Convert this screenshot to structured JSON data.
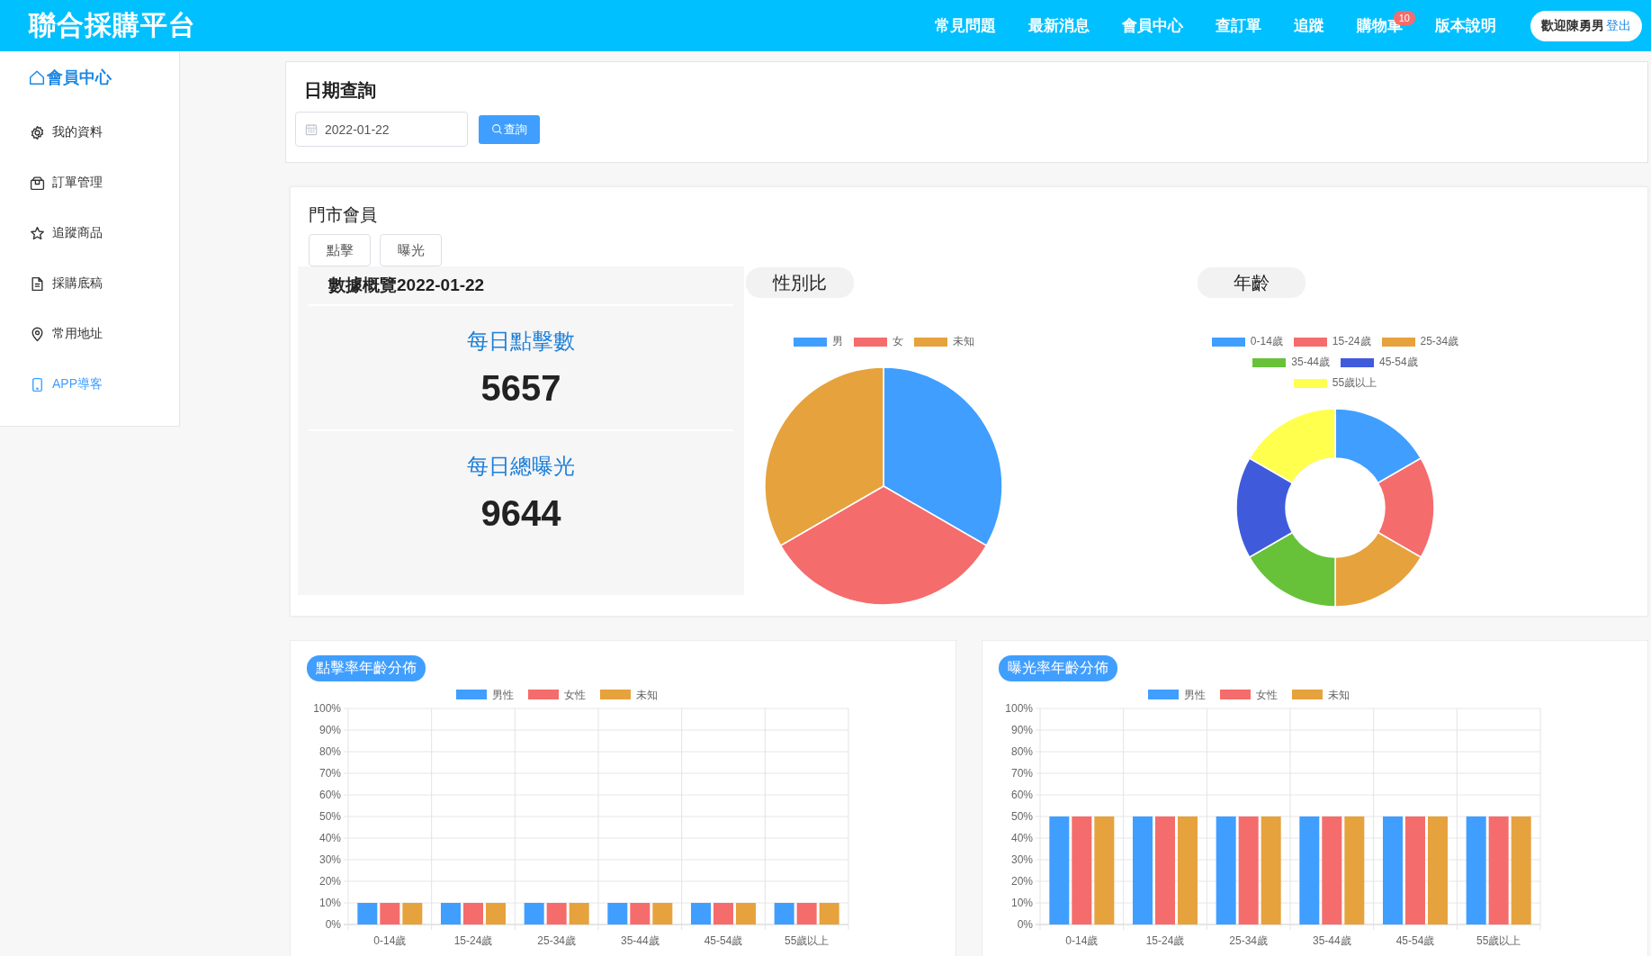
{
  "header": {
    "title": "聯合採購平台",
    "nav": [
      {
        "label": "常見問題"
      },
      {
        "label": "最新消息"
      },
      {
        "label": "會員中心"
      },
      {
        "label": "查訂單"
      },
      {
        "label": "追蹤"
      },
      {
        "label": "購物車",
        "badge": "10"
      },
      {
        "label": "版本說明"
      }
    ],
    "welcome": "歡迎陳勇男",
    "logout": "登出"
  },
  "sidebar": {
    "heading": "會員中心",
    "items": [
      {
        "label": "我的資料",
        "kind": "gear",
        "selected": false
      },
      {
        "label": "訂單管理",
        "kind": "box",
        "selected": false
      },
      {
        "label": "追蹤商品",
        "kind": "star",
        "selected": false
      },
      {
        "label": "採購底稿",
        "kind": "document",
        "selected": false
      },
      {
        "label": "常用地址",
        "kind": "pin",
        "selected": false
      },
      {
        "label": "APP導客",
        "kind": "phone",
        "selected": true
      }
    ]
  },
  "date_query": {
    "title": "日期查詢",
    "date_field": {
      "value": "2022-01-22"
    },
    "button": "查詢"
  },
  "store_members": {
    "title": "門市會員",
    "tabs": [
      "點擊",
      "曝光"
    ],
    "overview": {
      "title": "數據概覽2022-01-22",
      "stats": [
        {
          "label": "每日點擊數",
          "value": "5657"
        },
        {
          "label": "每日總曝光",
          "value": "9644"
        }
      ]
    },
    "gender_chart": {
      "title": "性別比",
      "legend": [
        {
          "label": "男",
          "color": "#409eff"
        },
        {
          "label": "女",
          "color": "#f56c6c"
        },
        {
          "label": "未知",
          "color": "#e6a23c"
        }
      ]
    },
    "age_chart": {
      "title": "年齡",
      "legend": [
        {
          "label": "0-14歲",
          "color": "#409eff"
        },
        {
          "label": "15-24歲",
          "color": "#f56c6c"
        },
        {
          "label": "25-34歲",
          "color": "#e6a23c"
        },
        {
          "label": "35-44歲",
          "color": "#67c23a"
        },
        {
          "label": "45-54歲",
          "color": "#3f5bdc"
        },
        {
          "label": "55歲以上",
          "color": "#ffff4d"
        }
      ]
    }
  },
  "click_rate_chart": {
    "title": "點擊率年齡分佈",
    "chart_data": {
      "type": "bar",
      "categories": [
        "0-14歲",
        "15-24歲",
        "25-34歲",
        "35-44歲",
        "45-54歲",
        "55歲以上"
      ],
      "series": [
        {
          "name": "男性",
          "color": "#409eff",
          "values": [
            10,
            10,
            10,
            10,
            10,
            10
          ]
        },
        {
          "name": "女性",
          "color": "#f56c6c",
          "values": [
            10,
            10,
            10,
            10,
            10,
            10
          ]
        },
        {
          "name": "未知",
          "color": "#e6a23c",
          "values": [
            10,
            10,
            10,
            10,
            10,
            10
          ]
        }
      ],
      "grid": true,
      "legend": true,
      "ylim": [
        0,
        100
      ],
      "yticks": [
        {
          "value": 0,
          "label": "0%"
        },
        {
          "value": 10,
          "label": "10%"
        },
        {
          "value": 20,
          "label": "20%"
        },
        {
          "value": 30,
          "label": "30%"
        },
        {
          "value": 40,
          "label": "40%"
        },
        {
          "value": 50,
          "label": "50%"
        },
        {
          "value": 60,
          "label": "60%"
        },
        {
          "value": 70,
          "label": "70%"
        },
        {
          "value": 80,
          "label": "80%"
        },
        {
          "value": 90,
          "label": "90%"
        },
        {
          "value": 100,
          "label": "100%"
        }
      ]
    }
  },
  "exposure_rate_chart": {
    "title": "曝光率年齡分佈",
    "chart_data": {
      "type": "bar",
      "categories": [
        "0-14歲",
        "15-24歲",
        "25-34歲",
        "35-44歲",
        "45-54歲",
        "55歲以上"
      ],
      "series": [
        {
          "name": "男性",
          "color": "#409eff",
          "values": [
            50,
            50,
            50,
            50,
            50,
            50
          ]
        },
        {
          "name": "女性",
          "color": "#f56c6c",
          "values": [
            50,
            50,
            50,
            50,
            50,
            50
          ]
        },
        {
          "name": "未知",
          "color": "#e6a23c",
          "values": [
            50,
            50,
            50,
            50,
            50,
            50
          ]
        }
      ],
      "grid": true,
      "legend": true,
      "ylim": [
        0,
        100
      ],
      "yticks": [
        {
          "value": 0,
          "label": "0%"
        },
        {
          "value": 10,
          "label": "10%"
        },
        {
          "value": 20,
          "label": "20%"
        },
        {
          "value": 30,
          "label": "30%"
        },
        {
          "value": 40,
          "label": "40%"
        },
        {
          "value": 50,
          "label": "50%"
        },
        {
          "value": 60,
          "label": "60%"
        },
        {
          "value": 70,
          "label": "70%"
        },
        {
          "value": 80,
          "label": "80%"
        },
        {
          "value": 90,
          "label": "90%"
        },
        {
          "value": 100,
          "label": "100%"
        }
      ]
    }
  }
}
